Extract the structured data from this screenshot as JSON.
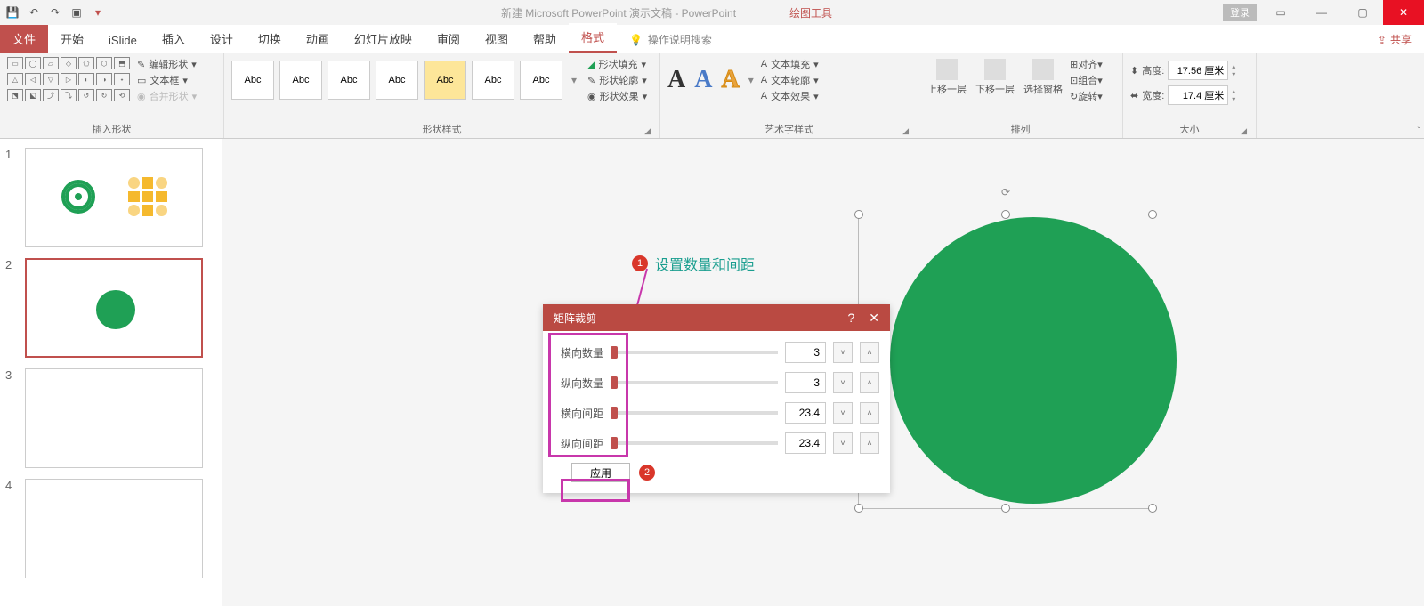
{
  "title": {
    "app": "新建 Microsoft PowerPoint 演示文稿 - PowerPoint",
    "context_tab": "绘图工具"
  },
  "window": {
    "login": "登录"
  },
  "tabs": {
    "file": "文件",
    "home": "开始",
    "islide": "iSlide",
    "insert": "插入",
    "design": "设计",
    "transition": "切换",
    "animation": "动画",
    "slideshow": "幻灯片放映",
    "review": "审阅",
    "view": "视图",
    "help": "帮助",
    "format": "格式",
    "tellme": "操作说明搜索",
    "share": "共享"
  },
  "ribbon": {
    "insert_shape": {
      "label": "插入形状",
      "edit_shape": "编辑形状",
      "text_box": "文本框",
      "merge": "合并形状"
    },
    "shape_style": {
      "label": "形状样式",
      "sample": "Abc",
      "fill": "形状填充",
      "outline": "形状轮廓",
      "effects": "形状效果"
    },
    "wordart": {
      "label": "艺术字样式",
      "text_fill": "文本填充",
      "text_outline": "文本轮廓",
      "text_effects": "文本效果"
    },
    "arrange": {
      "label": "排列",
      "bring_fwd": "上移一层",
      "send_back": "下移一层",
      "selection_pane": "选择窗格",
      "align": "对齐",
      "group": "组合",
      "rotate": "旋转"
    },
    "size": {
      "label": "大小",
      "height_label": "高度:",
      "height_val": "17.56 厘米",
      "width_label": "宽度:",
      "width_val": "17.4 厘米"
    }
  },
  "thumbs": [
    "1",
    "2",
    "3",
    "4"
  ],
  "annotation": {
    "step1": "1",
    "step1_text": "设置数量和间距",
    "step2": "2"
  },
  "dialog": {
    "title": "矩阵裁剪",
    "rows": {
      "h_count": {
        "label": "横向数量",
        "value": "3"
      },
      "v_count": {
        "label": "纵向数量",
        "value": "3"
      },
      "h_gap": {
        "label": "横向间距",
        "value": "23.4"
      },
      "v_gap": {
        "label": "纵向间距",
        "value": "23.4"
      }
    },
    "apply": "应用"
  }
}
